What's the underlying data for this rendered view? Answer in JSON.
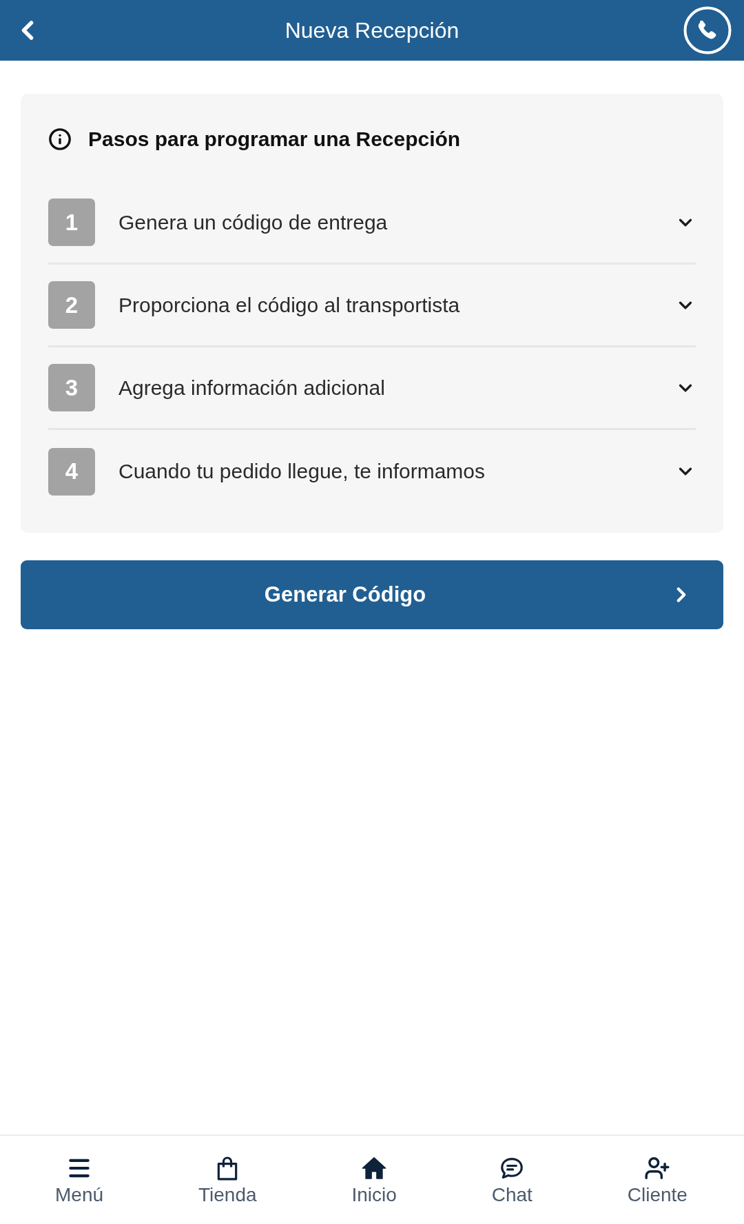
{
  "header": {
    "title": "Nueva Recepción"
  },
  "steps_card": {
    "title": "Pasos para programar una Recepción",
    "steps": [
      {
        "number": "1",
        "label": "Genera un código de entrega",
        "expanded": false
      },
      {
        "number": "2",
        "label": "Proporciona el código al transportista",
        "expanded": false
      },
      {
        "number": "3",
        "label": "Agrega información adicional",
        "expanded": false
      },
      {
        "number": "4",
        "label": "Cuando tu pedido llegue, te informamos",
        "expanded": false
      }
    ]
  },
  "primary_button": {
    "label": "Generar Código"
  },
  "bottom_nav": [
    {
      "kind": "menu",
      "label": "Menú"
    },
    {
      "kind": "store",
      "label": "Tienda"
    },
    {
      "kind": "home",
      "label": "Inicio"
    },
    {
      "kind": "chat",
      "label": "Chat"
    },
    {
      "kind": "add_user",
      "label": "Cliente"
    }
  ]
}
